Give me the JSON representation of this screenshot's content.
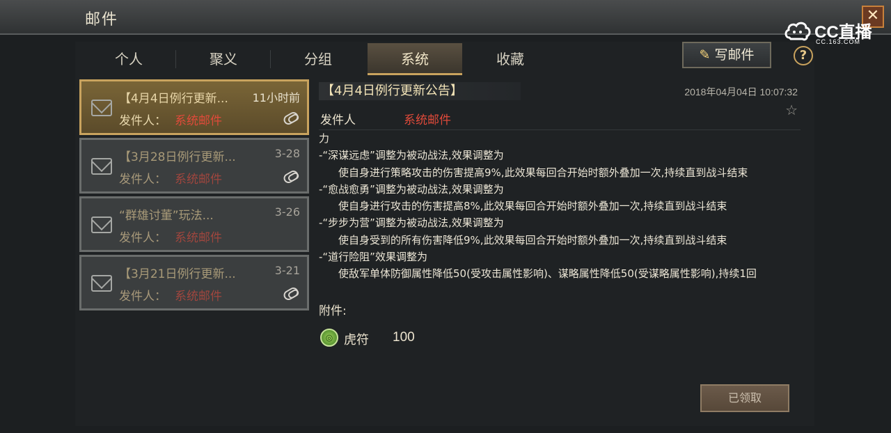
{
  "header": {
    "title": "邮件",
    "close_icon": "close-icon"
  },
  "watermark": {
    "brand": "CC直播",
    "url": "CC.163.COM"
  },
  "tabs": [
    {
      "label": "个人",
      "active": false
    },
    {
      "label": "聚义",
      "active": false
    },
    {
      "label": "分组",
      "active": false
    },
    {
      "label": "系统",
      "active": true
    },
    {
      "label": "收藏",
      "active": false
    }
  ],
  "toolbar": {
    "write_label": "写邮件",
    "help_label": "?"
  },
  "mail_list": [
    {
      "title": "【4月4日例行更新...",
      "time": "11小时前",
      "sender_label": "发件人：",
      "sender": "系统邮件",
      "has_attachment": true,
      "active": true
    },
    {
      "title": "【3月28日例行更新...",
      "time": "3-28",
      "sender_label": "发件人：",
      "sender": "系统邮件",
      "has_attachment": true,
      "active": false
    },
    {
      "title": "“群雄讨董”玩法...",
      "time": "3-26",
      "sender_label": "发件人：",
      "sender": "系统邮件",
      "has_attachment": false,
      "active": false
    },
    {
      "title": "【3月21日例行更新...",
      "time": "3-21",
      "sender_label": "发件人：",
      "sender": "系统邮件",
      "has_attachment": true,
      "active": false
    }
  ],
  "detail": {
    "title": "【4月4日例行更新公告】",
    "date": "2018年04月04日 10:07:32",
    "sender_label": "发件人",
    "sender": "系统邮件",
    "body": [
      {
        "text": "力",
        "indent": false
      },
      {
        "text": "-“深谋远虑”调整为被动战法,效果调整为",
        "indent": false
      },
      {
        "text": "使自身进行策略攻击的伤害提高9%,此效果每回合开始时额外叠加一次,持续直到战斗结束",
        "indent": true
      },
      {
        "text": "-“愈战愈勇”调整为被动战法,效果调整为",
        "indent": false
      },
      {
        "text": "使自身进行攻击的伤害提高8%,此效果每回合开始时额外叠加一次,持续直到战斗结束",
        "indent": true
      },
      {
        "text": "-“步步为营”调整为被动战法,效果调整为",
        "indent": false
      },
      {
        "text": "使自身受到的所有伤害降低9%,此效果每回合开始时额外叠加一次,持续直到战斗结束",
        "indent": true
      },
      {
        "text": "-“道行险阻”效果调整为",
        "indent": false
      },
      {
        "text": "使敌军单体防御属性降低50(受攻击属性影响)、谋略属性降低50(受谋略属性影响),持续1回",
        "indent": true
      }
    ],
    "attachment_label": "附件:",
    "attachment": {
      "icon": "tiger-tally-icon",
      "name": "虎符",
      "quantity": "100"
    },
    "claim_label": "已领取"
  },
  "colors": {
    "accent": "#c9a35e",
    "sender_red": "#e04a3a",
    "background": "#1c1f21"
  }
}
